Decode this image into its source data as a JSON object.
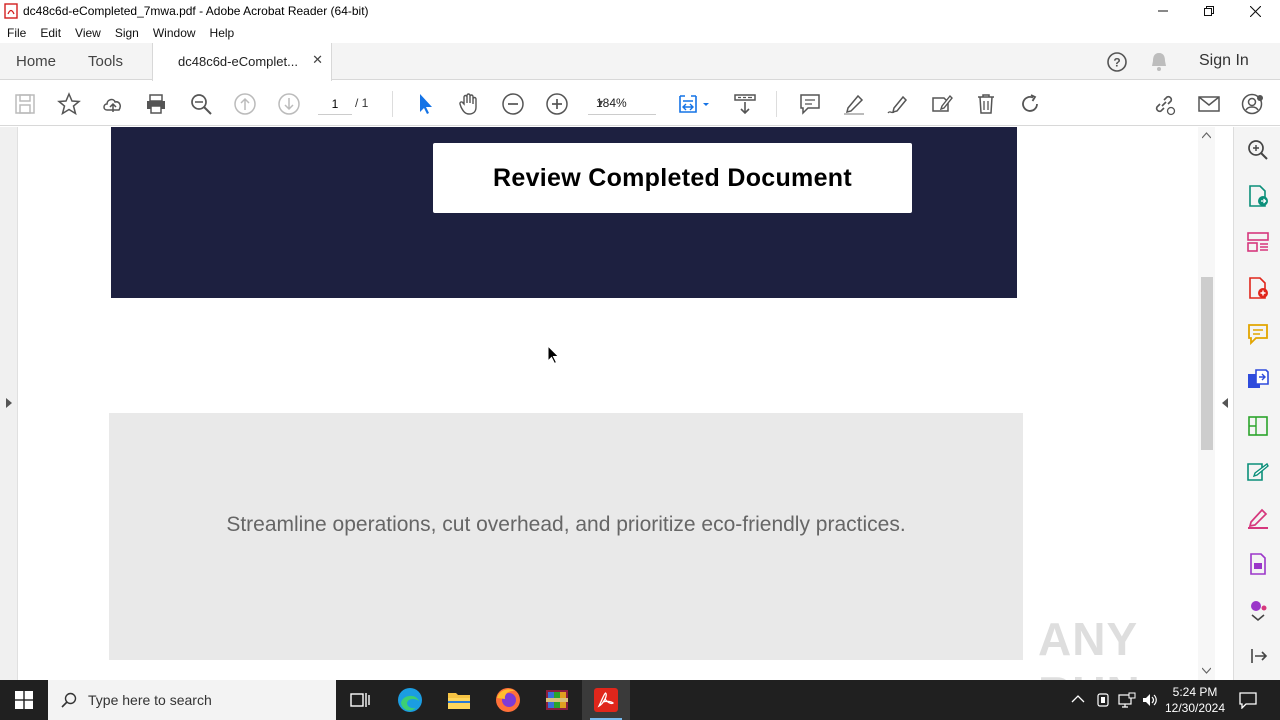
{
  "window": {
    "title": "dc48c6d-eCompleted_7mwa.pdf - Adobe Acrobat Reader (64-bit)"
  },
  "menu": [
    "File",
    "Edit",
    "View",
    "Sign",
    "Window",
    "Help"
  ],
  "tabs": {
    "home": "Home",
    "tools": "Tools",
    "document": "dc48c6d-eComplet...",
    "sign_in": "Sign In"
  },
  "toolbar": {
    "page_current": "1",
    "page_total": "/ 1",
    "zoom": "184%"
  },
  "document": {
    "button_text": "Review Completed Document",
    "body_text": "Streamline operations, cut overhead, and prioritize eco-friendly practices.",
    "banner_color": "#1d2040"
  },
  "watermark": "ANY RUN",
  "taskbar": {
    "search_placeholder": "Type here to search",
    "time": "5:24 PM",
    "date": "12/30/2024"
  },
  "colors": {
    "accent_red": "#e0261b",
    "accent_blue": "#1473e6"
  }
}
